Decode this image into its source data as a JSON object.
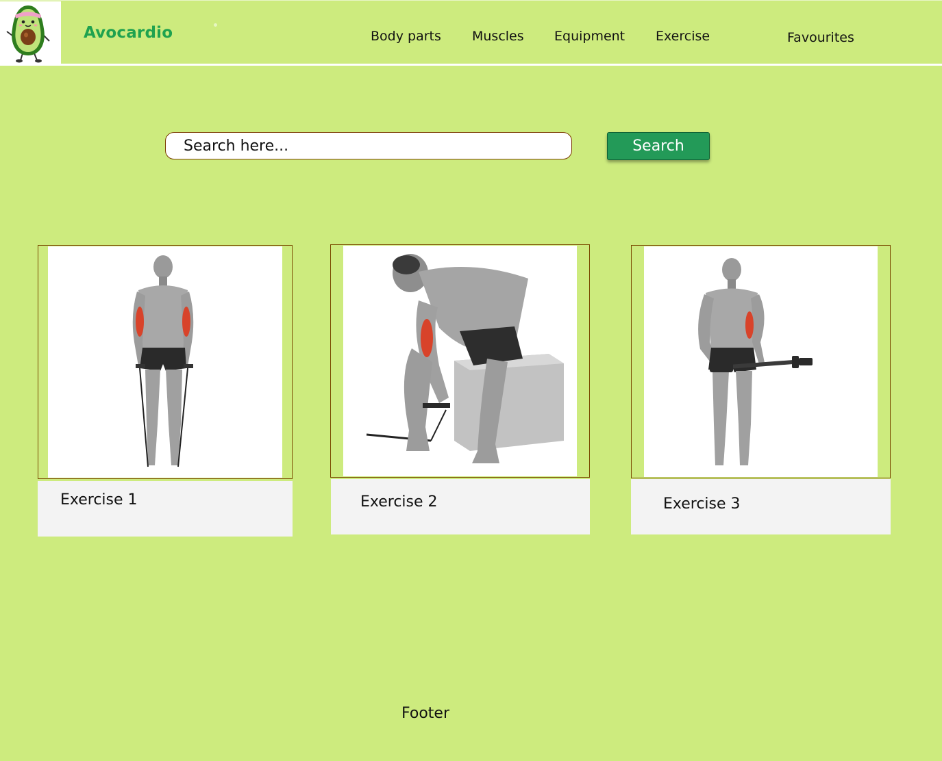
{
  "brand": {
    "name": "Avocardio",
    "logo_icon": "avocado-mascot-icon"
  },
  "nav": {
    "items": [
      "Body parts",
      "Muscles",
      "Equipment",
      "Exercise"
    ],
    "favourites": "Favourites"
  },
  "search": {
    "placeholder": "Search here...",
    "button_label": "Search"
  },
  "cards": [
    {
      "label": "Exercise 1",
      "image": "band-curl-illustration"
    },
    {
      "label": "Exercise 2",
      "image": "seated-cable-curl-illustration"
    },
    {
      "label": "Exercise 3",
      "image": "barbell-curl-illustration"
    }
  ],
  "footer": {
    "text": "Footer"
  },
  "colors": {
    "background": "#cdeb7e",
    "brand": "#1fa24f",
    "button": "#239a58",
    "card_label_bg": "#f3f3f3",
    "highlight_muscle": "#e0402a"
  }
}
